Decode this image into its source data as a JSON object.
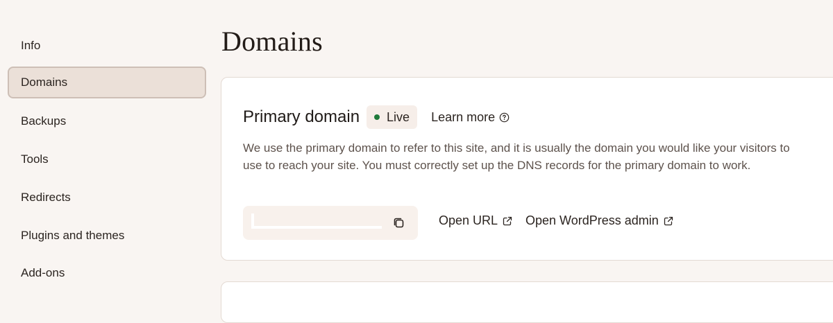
{
  "sidebar": {
    "items": [
      {
        "label": "Info"
      },
      {
        "label": "Domains",
        "active": true
      },
      {
        "label": "Backups"
      },
      {
        "label": "Tools"
      },
      {
        "label": "Redirects"
      },
      {
        "label": "Plugins and themes"
      },
      {
        "label": "Add-ons"
      }
    ]
  },
  "page": {
    "title": "Domains"
  },
  "primary_domain": {
    "title": "Primary domain",
    "status": "Live",
    "status_color": "#1f7a3b",
    "learn_more": "Learn more",
    "description": "We use the primary domain to refer to this site, and it is usually the domain you would like your visitors to use to reach your site. You must correctly set up the DNS records for the primary domain to work.",
    "domain_value": "",
    "open_url": "Open URL",
    "open_admin": "Open WordPress admin",
    "icons": [
      "help-circle-icon",
      "copy-icon",
      "external-link-icon"
    ]
  }
}
